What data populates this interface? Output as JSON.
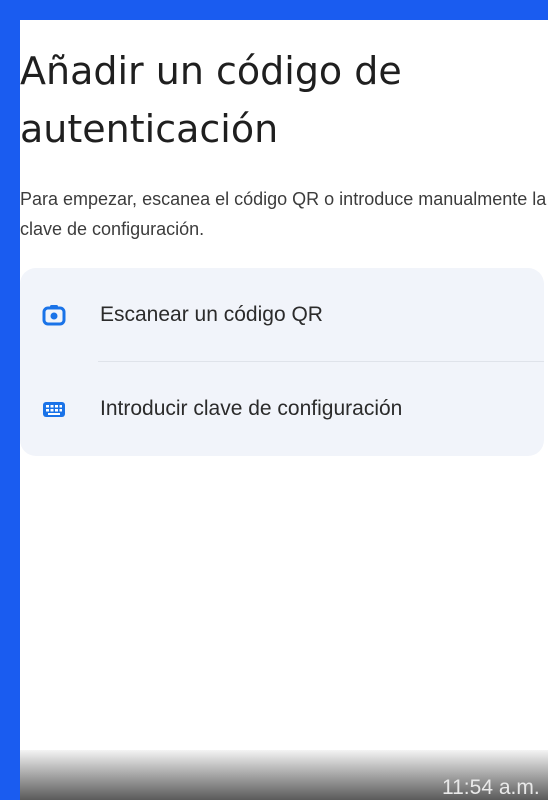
{
  "page": {
    "title": "Añadir un código de autenticación",
    "subtitle": "Para empezar, escanea el código QR o introduce manualmente la clave de configuración."
  },
  "options": [
    {
      "label": "Escanear un código QR",
      "icon": "camera-icon"
    },
    {
      "label": "Introducir clave de configuración",
      "icon": "keyboard-icon"
    }
  ],
  "status_bar": {
    "time": "11:54 a.m."
  },
  "colors": {
    "frame_border": "#1a5cf0",
    "card_background": "#f1f4fa",
    "icon_accent": "#1a73e8"
  }
}
